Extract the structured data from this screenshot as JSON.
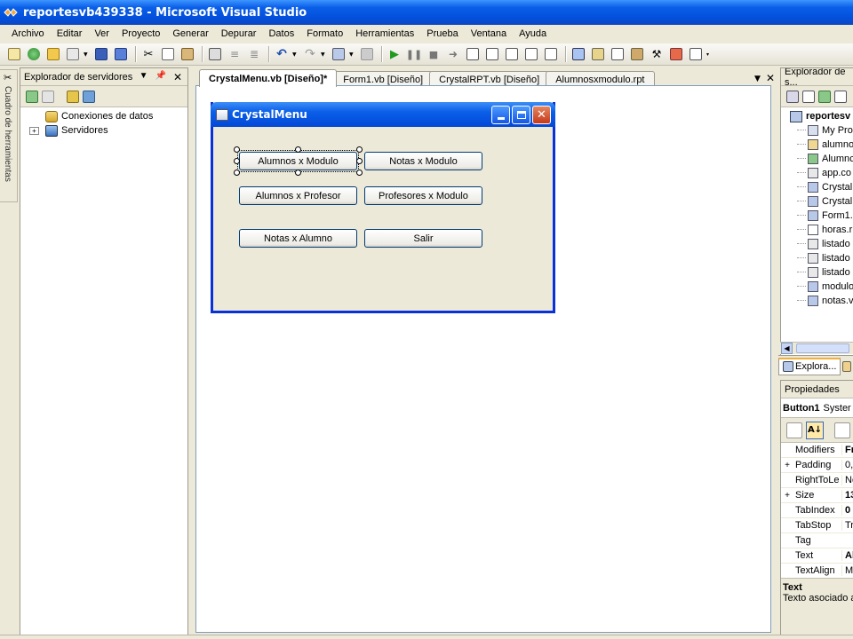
{
  "window": {
    "title": "reportesvb439338 - Microsoft Visual Studio"
  },
  "menu": [
    "Archivo",
    "Editar",
    "Ver",
    "Proyecto",
    "Generar",
    "Depurar",
    "Datos",
    "Formato",
    "Herramientas",
    "Prueba",
    "Ventana",
    "Ayuda"
  ],
  "toolbox_tab": {
    "label": "Cuadro de herramientas"
  },
  "server_explorer": {
    "title": "Explorador de servidores",
    "items": [
      {
        "label": "Conexiones de datos",
        "expander": ""
      },
      {
        "label": "Servidores",
        "expander": "+"
      }
    ]
  },
  "doc_tabs": [
    {
      "label": "CrystalMenu.vb [Diseño]*",
      "active": true
    },
    {
      "label": "Form1.vb [Diseño]",
      "active": false
    },
    {
      "label": "CrystalRPT.vb [Diseño]",
      "active": false
    },
    {
      "label": "Alumnosxmodulo.rpt",
      "active": false
    }
  ],
  "form": {
    "title": "CrystalMenu",
    "buttons": [
      {
        "label": "Alumnos x Modulo",
        "selected": true
      },
      {
        "label": "Notas x Modulo",
        "selected": false
      },
      {
        "label": "Alumnos x Profesor",
        "selected": false
      },
      {
        "label": "Profesores x Modulo",
        "selected": false
      },
      {
        "label": "Notas x Alumno",
        "selected": false
      },
      {
        "label": "Salir",
        "selected": false
      }
    ]
  },
  "solution_explorer": {
    "title": "Explorador de s...",
    "root": "reportesv",
    "items": [
      "My Pro",
      "alumno",
      "Alumnc",
      "app.co",
      "Crystal",
      "Crystal",
      "Form1.",
      "horas.r",
      "listado",
      "listado",
      "listado",
      "modulo",
      "notas.v"
    ],
    "bottom_tab": "Explora..."
  },
  "properties": {
    "title": "Propiedades",
    "object": "Button1",
    "object_type": "Syster",
    "rows": [
      {
        "expander": "",
        "name": "Modifiers",
        "value": "Fri",
        "bold": true
      },
      {
        "expander": "+",
        "name": "Padding",
        "value": "0,",
        "bold": false
      },
      {
        "expander": "",
        "name": "RightToLe",
        "value": "No",
        "bold": false
      },
      {
        "expander": "+",
        "name": "Size",
        "value": "13",
        "bold": true
      },
      {
        "expander": "",
        "name": "TabIndex",
        "value": "0",
        "bold": true
      },
      {
        "expander": "",
        "name": "TabStop",
        "value": "Tru",
        "bold": false
      },
      {
        "expander": "",
        "name": "Tag",
        "value": "",
        "bold": false
      },
      {
        "expander": "",
        "name": "Text",
        "value": "Al",
        "bold": true
      },
      {
        "expander": "",
        "name": "TextAlign",
        "value": "Mic",
        "bold": false
      }
    ],
    "desc_title": "Text",
    "desc_text": "Texto asociado a"
  },
  "colors": {
    "xp_blue": "#0A5FE8",
    "chrome": "#ECE9D8",
    "button_border": "#003C74"
  }
}
